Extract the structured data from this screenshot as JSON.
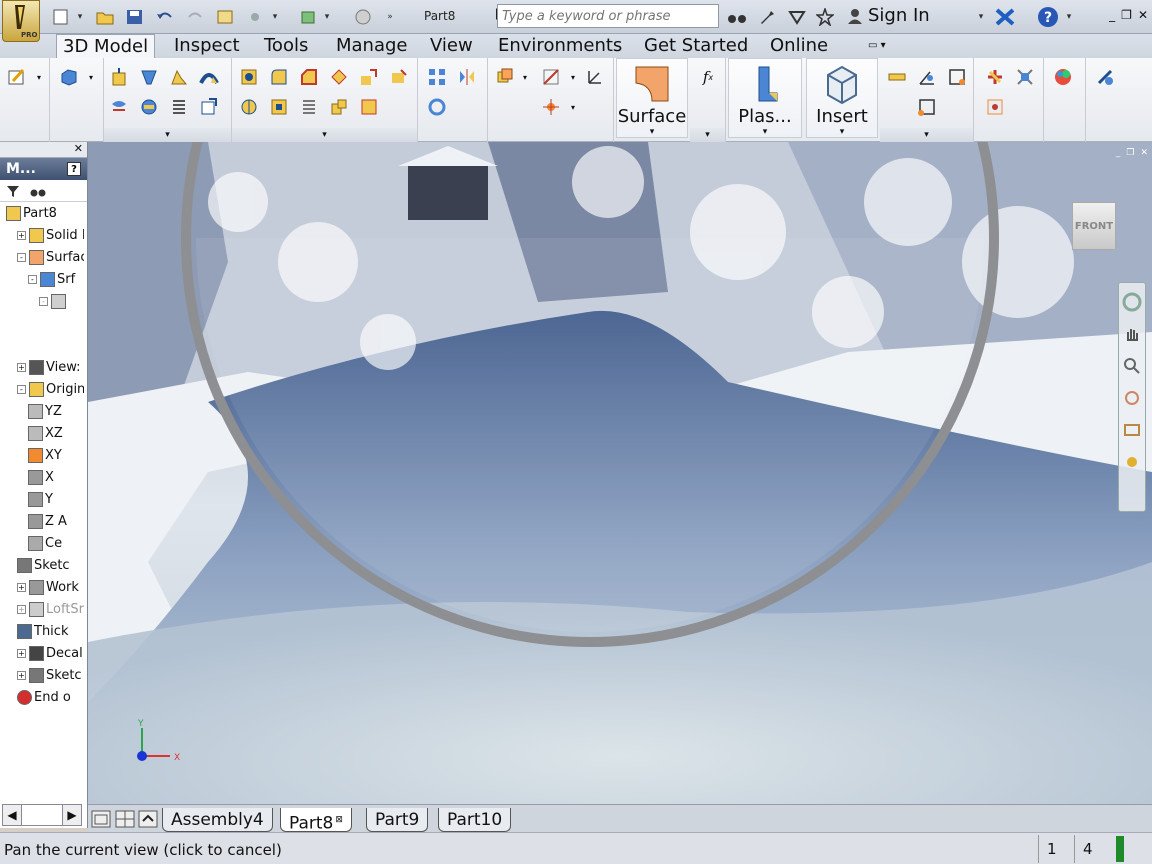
{
  "app": {
    "badge": "PRO",
    "document_title": "Part8",
    "search": {
      "placeholder": "Type a keyword or phrase"
    },
    "sign_in_label": "Sign In",
    "help_label": "?"
  },
  "ribbon_tabs": [
    {
      "label": "3D Model",
      "active": true
    },
    {
      "label": "Inspect"
    },
    {
      "label": "Tools"
    },
    {
      "label": "Manage"
    },
    {
      "label": "View"
    },
    {
      "label": "Environments"
    },
    {
      "label": "Get Started"
    },
    {
      "label": "Online"
    }
  ],
  "ribbon": {
    "surface_label": "Surface",
    "plastic_label": "Plas...",
    "insert_label": "Insert",
    "fx_label": "f",
    "fx_sub": "x"
  },
  "browser": {
    "title": "M...",
    "help": "?",
    "tree": [
      {
        "label": "Part8",
        "icon": "part-icon",
        "indent": 0,
        "exp": ""
      },
      {
        "label": "Solid B",
        "icon": "solid-bodies-icon",
        "indent": 1,
        "exp": "+"
      },
      {
        "label": "Surfac",
        "icon": "surface-bodies-icon",
        "indent": 1,
        "exp": "-"
      },
      {
        "label": "Srf",
        "icon": "surface-icon",
        "indent": 2,
        "exp": "-"
      },
      {
        "label": "",
        "icon": "feature-icon",
        "indent": 3,
        "exp": "-",
        "dim": true
      },
      {
        "label": "",
        "icon": "",
        "indent": 4,
        "exp": ""
      },
      {
        "label": "",
        "icon": "",
        "indent": 4,
        "exp": ""
      },
      {
        "label": "View:",
        "icon": "view-rep-icon",
        "indent": 1,
        "exp": "+"
      },
      {
        "label": "Origin",
        "icon": "origin-folder-icon",
        "indent": 1,
        "exp": "-"
      },
      {
        "label": "YZ",
        "icon": "plane-icon",
        "indent": 2,
        "exp": ""
      },
      {
        "label": "XZ",
        "icon": "plane-icon",
        "indent": 2,
        "exp": ""
      },
      {
        "label": "XY",
        "icon": "plane-active-icon",
        "indent": 2,
        "exp": ""
      },
      {
        "label": "X",
        "icon": "axis-icon",
        "indent": 2,
        "exp": ""
      },
      {
        "label": "Y",
        "icon": "axis-icon",
        "indent": 2,
        "exp": ""
      },
      {
        "label": "Z A",
        "icon": "axis-icon",
        "indent": 2,
        "exp": ""
      },
      {
        "label": "Ce",
        "icon": "center-point-icon",
        "indent": 2,
        "exp": ""
      },
      {
        "label": "Sketc",
        "icon": "sketch-icon",
        "indent": 1,
        "exp": ""
      },
      {
        "label": "Work",
        "icon": "work-plane-icon",
        "indent": 1,
        "exp": "+"
      },
      {
        "label": "LoftSr",
        "icon": "loft-icon",
        "indent": 1,
        "exp": "+",
        "dim": true
      },
      {
        "label": "Thick",
        "icon": "thicken-icon",
        "indent": 1,
        "exp": ""
      },
      {
        "label": "Decal",
        "icon": "decal-icon",
        "indent": 1,
        "exp": "+"
      },
      {
        "label": "Sketc",
        "icon": "sketch-icon",
        "indent": 1,
        "exp": "+"
      },
      {
        "label": "End o",
        "icon": "end-of-part-icon",
        "indent": 1,
        "exp": ""
      }
    ]
  },
  "viewcube_label": "FRONT",
  "triad": {
    "x": "X",
    "y": "Y"
  },
  "doc_tabs": [
    {
      "label": "Assembly4"
    },
    {
      "label": "Part8",
      "active": true,
      "close": "⊠"
    },
    {
      "label": "Part9"
    },
    {
      "label": "Part10"
    }
  ],
  "status": {
    "text": "Pan the current view (click to cancel)",
    "count1": "1",
    "count2": "4"
  },
  "colors": {
    "active_tab": "#f4f6f9",
    "surface_orange": "#f2a46a",
    "status_green": "#1f8a2c"
  }
}
